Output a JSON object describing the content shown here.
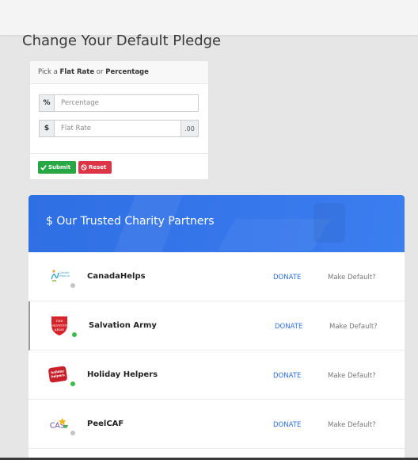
{
  "page": {
    "title": "Change Your Default Pledge"
  },
  "pledge_form": {
    "heading_prefix": "Pick a ",
    "heading_flat": "Flat Rate",
    "heading_or": " or ",
    "heading_pct": "Percentage",
    "percentage_addon": "%",
    "percentage_placeholder": "Percentage",
    "percentage_value": "",
    "flat_addon": "$",
    "flat_placeholder": "Flat Rate",
    "flat_value": "",
    "flat_suffix": ".00",
    "submit_label": "Submit",
    "reset_label": "Reset",
    "colors": {
      "submit": "#28a745",
      "reset": "#dc3545"
    }
  },
  "charities": {
    "title": "$ Our Trusted Charity Partners",
    "accent": "#3575ea",
    "donate_label": "DONATE",
    "default_label": "Make Default?",
    "items": [
      {
        "name": "CanadaHelps",
        "logo": "canadahelps-logo",
        "logo_text": "CanadaHelps.org",
        "status": "inactive",
        "status_color": "#c4c4c4"
      },
      {
        "name": "Salvation Army",
        "logo": "salvation-army-shield-logo",
        "logo_text": "THE SALVATION ARMY",
        "status": "active",
        "status_color": "#3dbb4a"
      },
      {
        "name": "Holiday Helpers",
        "logo": "holiday-helpers-logo",
        "logo_text": "holiday helpers",
        "status": "active",
        "status_color": "#3dbb4a"
      },
      {
        "name": "PeelCAF",
        "logo": "cas-logo",
        "logo_text": "CAS",
        "status": "inactive",
        "status_color": "#c4c4c4"
      }
    ]
  }
}
